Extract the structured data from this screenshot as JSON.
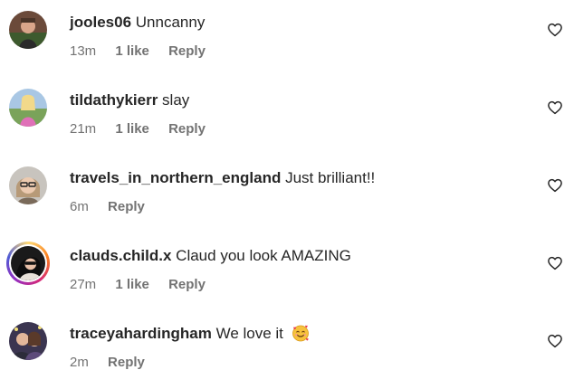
{
  "comments": [
    {
      "username": "jooles06",
      "text": "Unncanny",
      "time": "13m",
      "likes": "1 like",
      "reply": "Reply",
      "has_story_ring": false,
      "has_emoji": false
    },
    {
      "username": "tildathykierr",
      "text": "slay",
      "time": "21m",
      "likes": "1 like",
      "reply": "Reply",
      "has_story_ring": false,
      "has_emoji": false
    },
    {
      "username": "travels_in_northern_england",
      "text": "Just brilliant!!",
      "time": "6m",
      "likes": "",
      "reply": "Reply",
      "has_story_ring": false,
      "has_emoji": false
    },
    {
      "username": "clauds.child.x",
      "text": "Claud you look AMAZING",
      "time": "27m",
      "likes": "1 like",
      "reply": "Reply",
      "has_story_ring": true,
      "has_emoji": false
    },
    {
      "username": "traceyahardingham",
      "text": "We love it",
      "time": "2m",
      "likes": "",
      "reply": "Reply",
      "has_story_ring": false,
      "has_emoji": true,
      "emoji": "smiling-face-with-hearts-icon"
    }
  ],
  "icons": {
    "like": "heart-outline-icon"
  },
  "colors": {
    "text": "#262626",
    "meta": "#737373"
  }
}
